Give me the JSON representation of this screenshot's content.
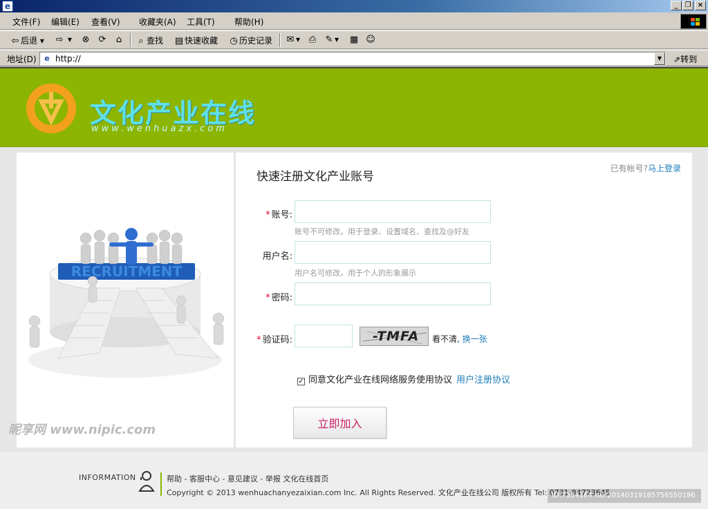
{
  "browser": {
    "menu": [
      "文件(F)",
      "编辑(E)",
      "查看(V)",
      "收藏夹(A)",
      "工具(T)",
      "帮助(H)"
    ],
    "toolbar": {
      "back": "后退",
      "search": "查找",
      "favorites": "快速收藏",
      "history": "历史记录"
    },
    "address_label": "地址(D)",
    "address_value": "http://",
    "go_label": "转到"
  },
  "site": {
    "logo_text": "文化产业在线",
    "logo_url": "www.wenhuazx.com"
  },
  "form": {
    "title": "快速注册文化产业账号",
    "login_prompt": "已有帐号?",
    "login_link": "马上登录",
    "required_mark": "*",
    "account_label": "账号:",
    "account_hint": "账号不可修改，用于登录、设置域名、查找及@好友",
    "username_label": "用户名:",
    "username_hint": "用户名可修改，用于个人的形象展示",
    "password_label": "密码:",
    "captcha_label": "验证码:",
    "captcha_text": "-TMFA",
    "captcha_unclear": "看不清,",
    "captcha_refresh": "换一张",
    "agree_text": "同意文化产业在线网络服务使用协议",
    "agree_link": "用户注册协议",
    "agree_checked": true,
    "submit_label": "立即加入"
  },
  "illustration": {
    "banner_text": "RECRUITMENT"
  },
  "footer": {
    "info_label": "INFORMATION",
    "links": [
      "帮助",
      "客服中心",
      "意见建议",
      "举报",
      "文化在线首页"
    ],
    "separator": " - ",
    "copyright": "Copyright © 2013 wenhuachanyezaixian.com Inc. All Rights Reserved. 文化产业在线公司 版权所有  Tel: 0731-84723645"
  },
  "watermarks": {
    "left": "昵享网 www.nipic.com",
    "right": "ID:7354164 NO:20140319185756550196"
  },
  "colors": {
    "header_green": "#8bb500",
    "logo_cyan": "#5fe0e8",
    "logo_orange": "#f2a01e",
    "link_blue": "#1c7cb8",
    "required_red": "#e0002a",
    "button_text": "#c81e64"
  }
}
